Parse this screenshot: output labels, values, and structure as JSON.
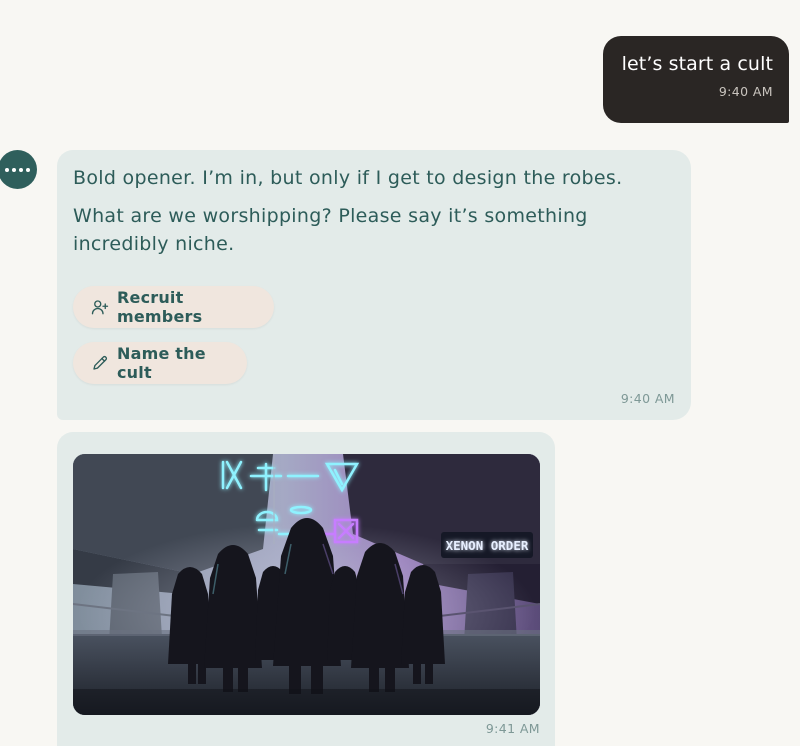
{
  "messages": {
    "user": {
      "text": "let’s start a cult",
      "time": "9:40 AM"
    },
    "assistant": {
      "paragraph_1": "Bold opener. I’m in, but only if I get to design the robes.",
      "paragraph_2": "What are we worshipping? Please say it’s something incredibly niche.",
      "time": "9:40 AM",
      "suggestions": [
        {
          "label": "Recruit members",
          "icon": "user-plus-icon"
        },
        {
          "label": "Name the cult",
          "icon": "pencil-icon"
        }
      ]
    },
    "image_message": {
      "sign_text": "XENON ORDER",
      "time": "9:41 AM"
    }
  },
  "colors": {
    "background": "#f8f7f3",
    "user_bubble": "#2a2624",
    "assistant_bubble": "#e3ebe9",
    "assistant_text": "#2d5c59",
    "chip_background": "#f0e6de",
    "avatar": "#2f5f5c",
    "neon_cyan": "#8ff2ff",
    "neon_purple": "#c77dff"
  }
}
